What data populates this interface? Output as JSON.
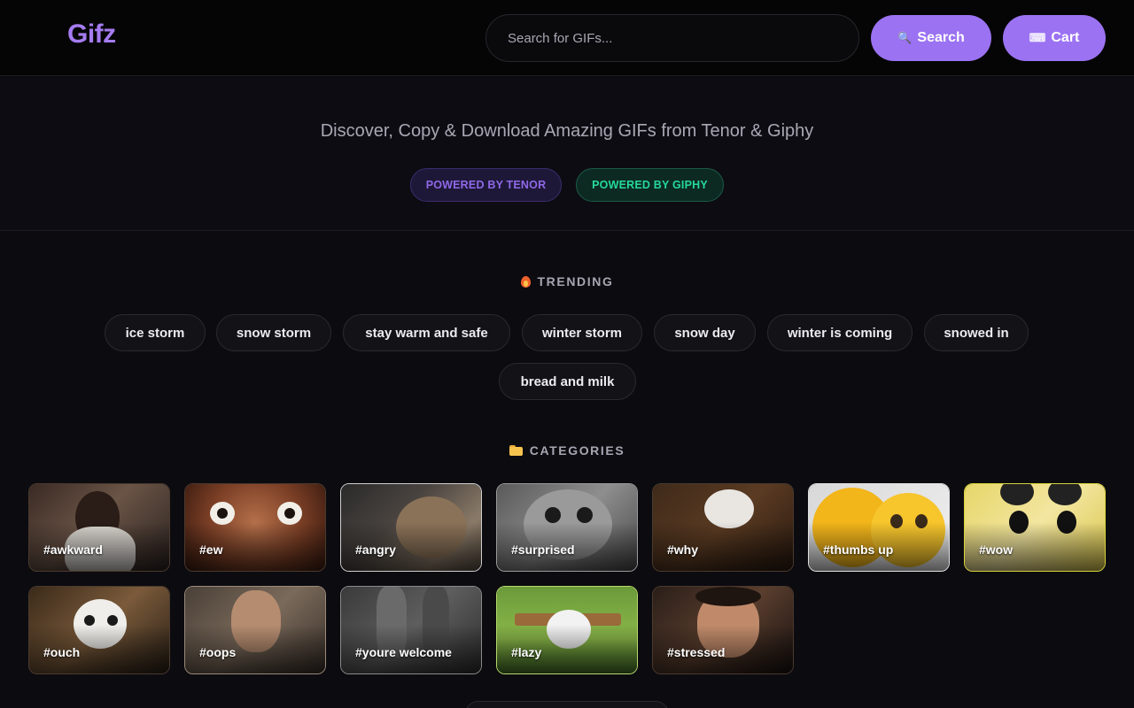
{
  "header": {
    "logo": "Gifz",
    "search": {
      "placeholder": "Search for GIFs...",
      "value": ""
    },
    "search_button": {
      "label": "Search",
      "icon": "magnifier-icon"
    },
    "cart_button": {
      "label": "Cart",
      "icon": "keyboard-icon"
    }
  },
  "hero": {
    "tagline": "Discover, Copy & Download Amazing GIFs from Tenor & Giphy",
    "badges": [
      {
        "label": "POWERED BY TENOR",
        "color": "#8f68e8"
      },
      {
        "label": "POWERED BY GIPHY",
        "color": "#27d79a"
      }
    ]
  },
  "trending": {
    "title": "TRENDING",
    "icon": "fire-icon",
    "chips": [
      "ice storm",
      "snow storm",
      "stay warm and safe",
      "winter storm",
      "snow day",
      "winter is coming",
      "snowed in",
      "bread and milk"
    ]
  },
  "categories": {
    "title": "CATEGORIES",
    "icon": "folder-icon",
    "items": [
      "#awkward",
      "#ew",
      "#angry",
      "#surprised",
      "#why",
      "#thumbs up",
      "#wow",
      "#ouch",
      "#oops",
      "#youre welcome",
      "#lazy",
      "#stressed"
    ]
  },
  "colors": {
    "accent": "#9b72f2",
    "logo": "#a57cf2",
    "background": "#0c0b10"
  }
}
